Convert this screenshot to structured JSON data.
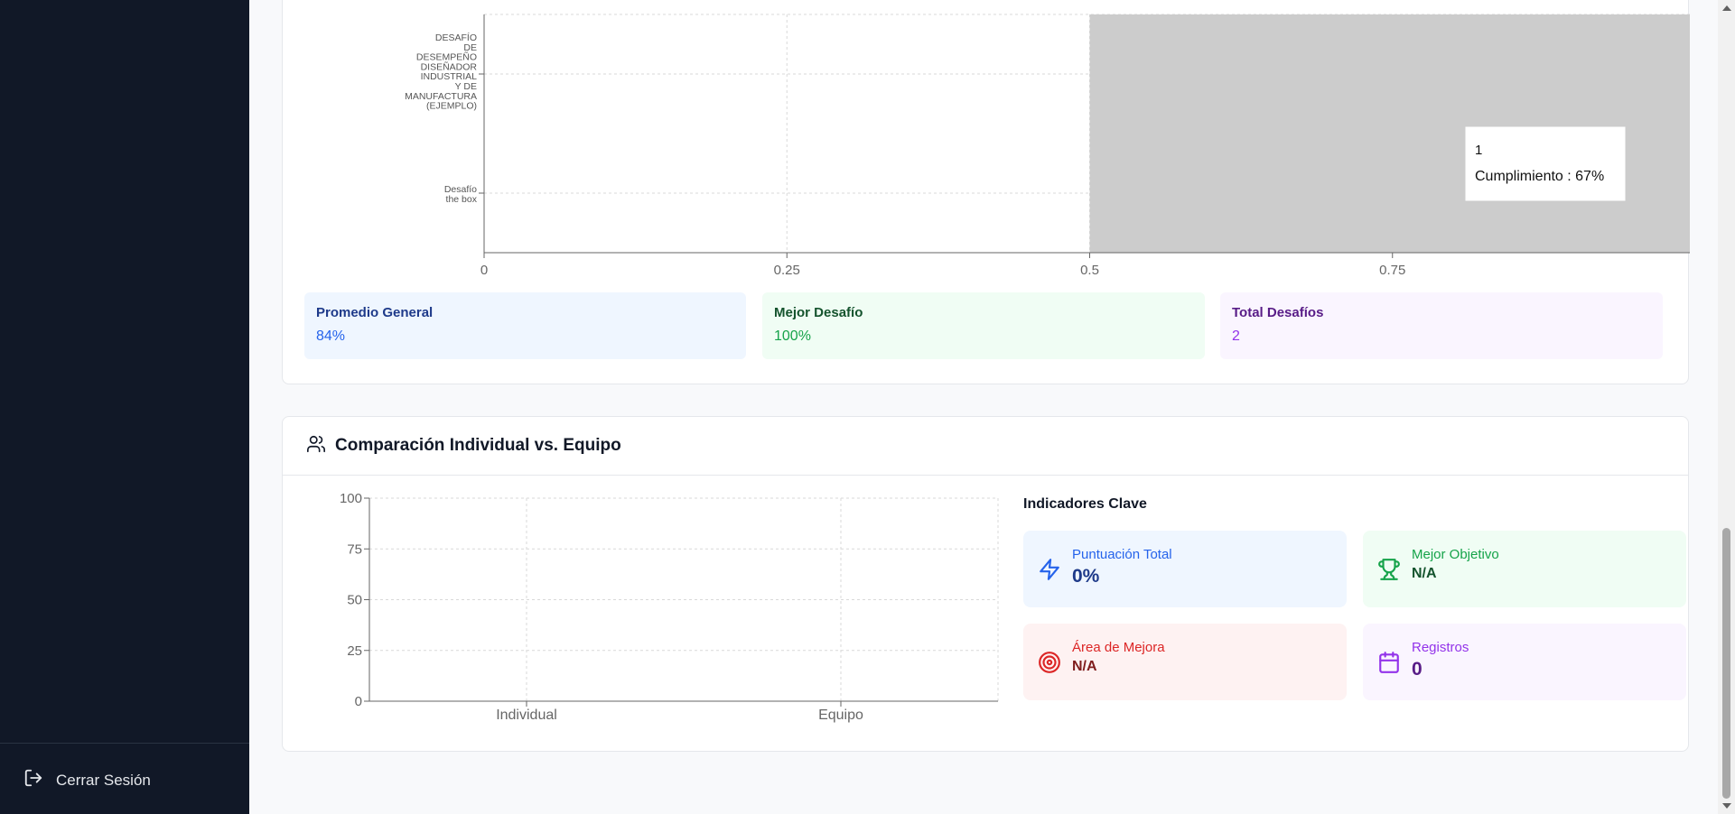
{
  "sidebar": {
    "logout_label": "Cerrar Sesión"
  },
  "challenge_chart": {
    "category_lines": [
      [
        "DESAFÍO",
        "DE",
        "DESEMPEÑO",
        "DISEÑADOR",
        "INDUSTRIAL",
        "Y DE",
        "MANUFACTURA",
        "(EJEMPLO)"
      ],
      [
        "Desafío",
        "the box"
      ]
    ],
    "tooltip": {
      "title": "1",
      "label": "Cumplimiento",
      "value": "67%"
    }
  },
  "stats": [
    {
      "label": "Promedio General",
      "value": "84%"
    },
    {
      "label": "Mejor Desafío",
      "value": "100%"
    },
    {
      "label": "Total Desafíos",
      "value": "2"
    }
  ],
  "comparison": {
    "title": "Comparación Individual vs. Equipo",
    "kpi_title": "Indicadores Clave",
    "kpis": [
      {
        "label": "Puntuación Total",
        "value": "0%"
      },
      {
        "label": "Mejor Objetivo",
        "value": "N/A"
      },
      {
        "label": "Área de Mejora",
        "value": "N/A"
      },
      {
        "label": "Registros",
        "value": "0"
      }
    ]
  },
  "chart_data": [
    {
      "type": "bar",
      "orientation": "horizontal",
      "categories": [
        "DESAFÍO DE DESEMPEÑO DISEÑADOR INDUSTRIAL Y DE MANUFACTURA (EJEMPLO)",
        "Desafío the box"
      ],
      "xlim": [
        0,
        1
      ],
      "x_ticks": [
        "0",
        "0.25",
        "0.5",
        "0.75",
        "1"
      ],
      "highlight_band": [
        0.5,
        1
      ],
      "grid": true,
      "tooltip": "1 / Cumplimiento : 67%"
    },
    {
      "type": "bar",
      "categories": [
        "Individual",
        "Equipo"
      ],
      "values": [
        0,
        0
      ],
      "ylim": [
        0,
        100
      ],
      "y_ticks": [
        "0",
        "25",
        "50",
        "75",
        "100"
      ],
      "grid": true
    }
  ]
}
